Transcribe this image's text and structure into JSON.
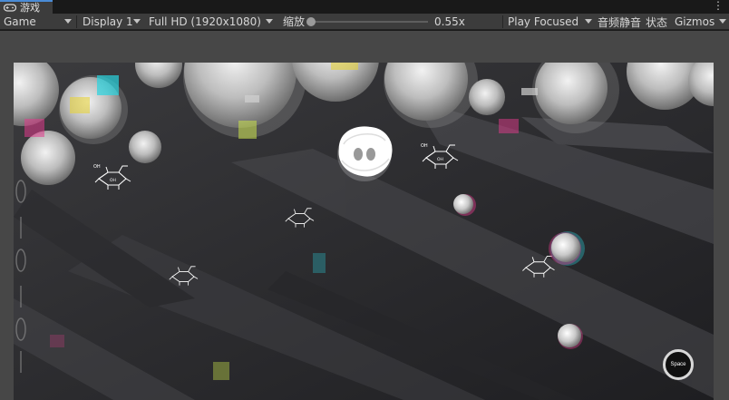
{
  "tab": {
    "label": "游戏",
    "icon": "gamepad-icon"
  },
  "window_menu": {
    "label": "⋮",
    "icon": "kebab-menu-icon"
  },
  "toolbar": {
    "view_mode": "Game",
    "display": "Display 1",
    "resolution": "Full HD (1920x1080)",
    "scale_label": "缩放",
    "scale_value": "0.55x",
    "scale_level": 0.55,
    "play_mode": "Play Focused",
    "mute_audio": "音频静音",
    "stats": "状态",
    "gizmos": "Gizmos"
  },
  "game": {
    "space_button": "Space",
    "molecule_label": "OH",
    "molecule_label_ch2": "OH",
    "accent_colors": {
      "cyan": "#2ad4e0",
      "magenta": "#e23a8c",
      "yellow": "#e6d23a"
    }
  }
}
